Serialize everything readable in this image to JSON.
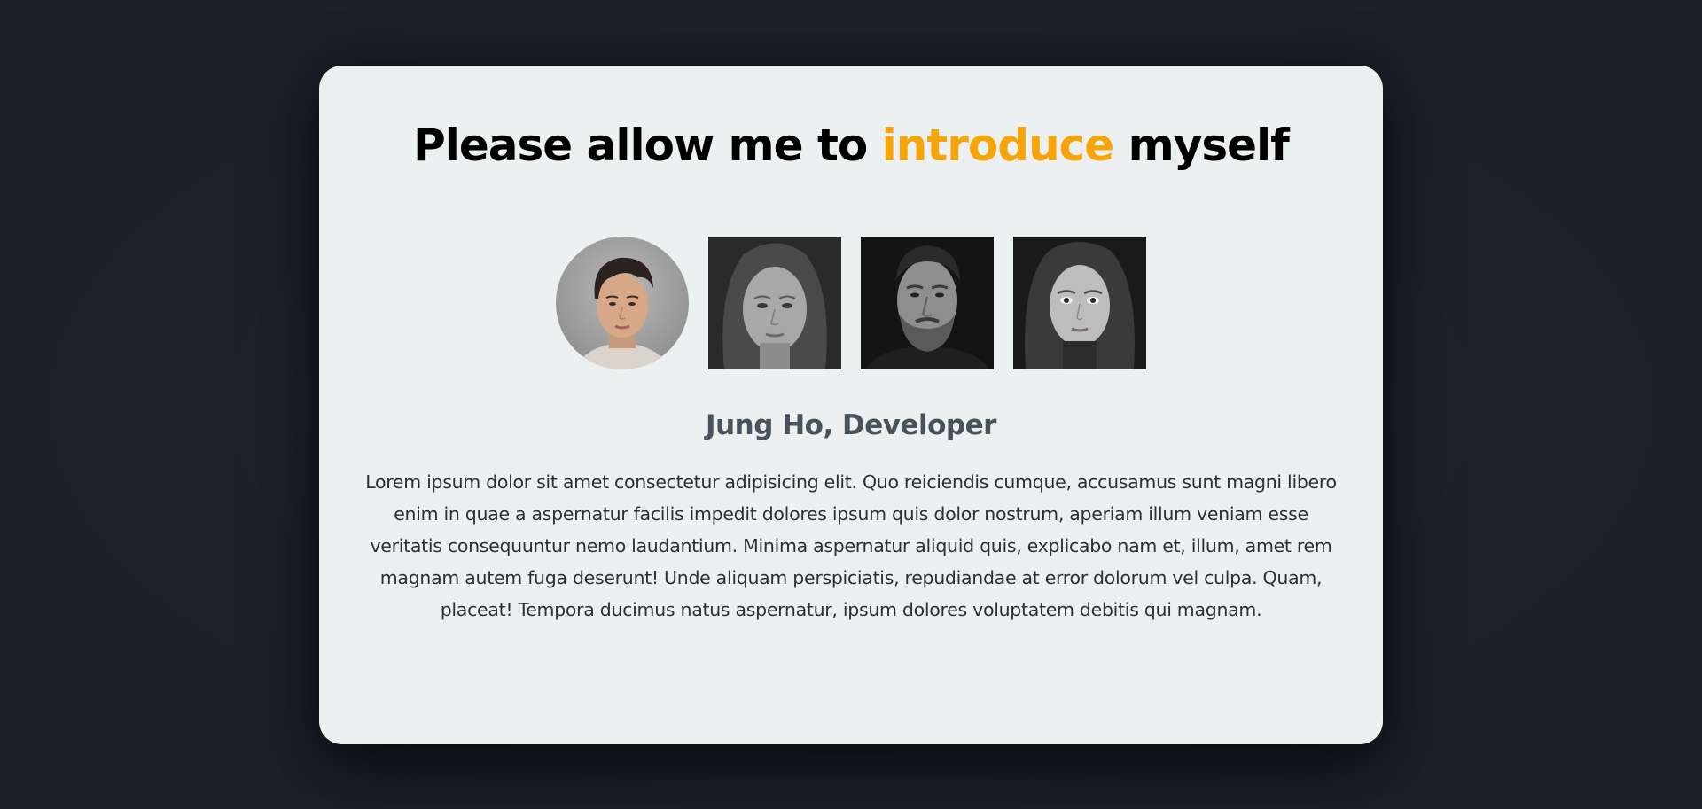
{
  "header": {
    "title_before": "Please allow me to ",
    "title_accent": "introduce",
    "title_after": " myself",
    "accent_color": "#f5a50a"
  },
  "people": [
    {
      "id": "person-1",
      "icon": "portrait-young-man",
      "active": true
    },
    {
      "id": "person-2",
      "icon": "portrait-woman-bw",
      "active": false
    },
    {
      "id": "person-3",
      "icon": "portrait-bearded-man-bw",
      "active": false
    },
    {
      "id": "person-4",
      "icon": "portrait-young-woman-bw",
      "active": false
    }
  ],
  "profile": {
    "name": "Jung Ho, Developer",
    "bio": "Lorem ipsum dolor sit amet consectetur adipisicing elit. Quo reiciendis cumque, accusamus sunt magni libero enim in quae a aspernatur facilis impedit dolores ipsum quis dolor nostrum, aperiam illum veniam esse veritatis consequuntur nemo laudantium. Minima aspernatur aliquid quis, explicabo nam et, illum, amet rem magnam autem fuga deserunt! Unde aliquam perspiciatis, repudiandae at error dolorum vel culpa. Quam, placeat! Tempora ducimus natus aspernatur, ipsum dolores voluptatem debitis qui magnam."
  },
  "colors": {
    "page_bg": "#1c222b",
    "card_bg": "#ecf0f1",
    "name_color": "#48525a"
  }
}
